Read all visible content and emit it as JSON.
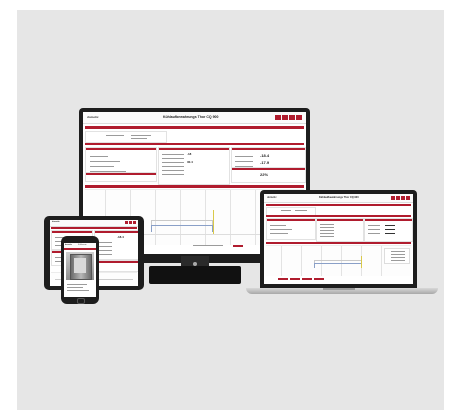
{
  "app": {
    "title": "Kühlaufbewahrungs Thor CQ 900",
    "logo": "dometic"
  },
  "values": {
    "temp_a": "-18.4",
    "temp_b": "-17.9",
    "temp_c": "23°C",
    "temp_d": "22%",
    "reading_1": "-18",
    "reading_2": "30.4"
  },
  "laptop": {
    "title": "Kühlaufbewahrungs Thor CQ 900",
    "logo": "dometic"
  },
  "tablet": {
    "logo": "dometic",
    "value": "-18.4"
  },
  "phone": {
    "logo": "dometic",
    "label": "Kühlraum"
  },
  "colors": {
    "accent": "#b01c2e",
    "bezel": "#1d1d1d",
    "background": "#e6e6e6"
  },
  "icons": {
    "apple": "apple-logo-icon"
  }
}
